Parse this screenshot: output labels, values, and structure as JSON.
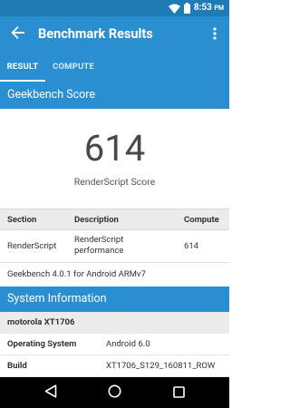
{
  "status_bar": {
    "time": "8:53",
    "ampm": "PM"
  },
  "app_bar": {
    "title": "Benchmark Results"
  },
  "tabs": [
    {
      "label": "RESULT",
      "selected": true
    },
    {
      "label": "COMPUTE",
      "selected": false
    }
  ],
  "geekbench": {
    "header": "Geekbench Score",
    "score": "614",
    "score_label": "RenderScript Score"
  },
  "table": {
    "headers": {
      "section": "Section",
      "description": "Description",
      "compute": "Compute"
    },
    "rows": [
      {
        "section": "RenderScript",
        "description": "RenderScript performance",
        "compute": "614"
      }
    ]
  },
  "version_text": "Geekbench 4.0.1 for Android ARMv7",
  "system_info": {
    "header": "System Information",
    "device": "motorola XT1706",
    "rows": [
      {
        "key": "Operating System",
        "value": "Android 6.0"
      },
      {
        "key": "Build",
        "value": "XT1706_S129_160811_ROW"
      }
    ]
  },
  "colors": {
    "primary": "#2a8fd0",
    "status_bar": "#1f7bb6",
    "row_gray": "#ececec"
  },
  "icons": {
    "back": "arrow-back-icon",
    "overflow": "more-vert-icon",
    "wifi": "wifi-icon",
    "battery": "battery-icon",
    "nav_back": "nav-back-icon",
    "nav_home": "nav-home-icon",
    "nav_recent": "nav-recent-icon"
  }
}
